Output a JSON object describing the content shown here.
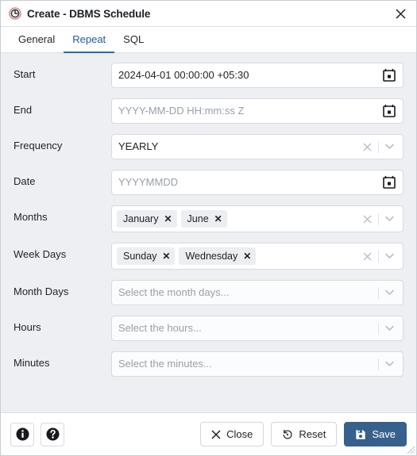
{
  "window": {
    "title": "Create - DBMS Schedule",
    "icon": "clock-icon",
    "close_label": "✕"
  },
  "tabs": [
    {
      "label": "General",
      "active": false
    },
    {
      "label": "Repeat",
      "active": true
    },
    {
      "label": "SQL",
      "active": false
    }
  ],
  "fields": [
    {
      "label": "Start",
      "type": "datetime",
      "value": "2024-04-01 00:00:00 +05:30",
      "placeholder": "YYYY-MM-DD HH:mm:ss Z",
      "icon": "calendar-icon"
    },
    {
      "label": "End",
      "type": "datetime",
      "value": "",
      "placeholder": "YYYY-MM-DD HH:mm:ss Z",
      "icon": "calendar-icon"
    },
    {
      "label": "Frequency",
      "type": "select",
      "value": "YEARLY",
      "placeholder": "",
      "has_clear": true
    },
    {
      "label": "Date",
      "type": "datetime",
      "value": "",
      "placeholder": "YYYYMMDD",
      "icon": "calendar-icon"
    },
    {
      "label": "Months",
      "type": "multiselect",
      "chips": [
        "January",
        "June"
      ],
      "placeholder": "",
      "has_clear": true
    },
    {
      "label": "Week Days",
      "type": "multiselect",
      "chips": [
        "Sunday",
        "Wednesday"
      ],
      "placeholder": "",
      "has_clear": true
    },
    {
      "label": "Month Days",
      "type": "multiselect",
      "chips": [],
      "placeholder": "Select the month days...",
      "has_clear": false
    },
    {
      "label": "Hours",
      "type": "multiselect",
      "chips": [],
      "placeholder": "Select the hours...",
      "has_clear": false
    },
    {
      "label": "Minutes",
      "type": "multiselect",
      "chips": [],
      "placeholder": "Select the minutes...",
      "has_clear": false
    }
  ],
  "footer": {
    "info_icon": "info-icon",
    "help_icon": "help-icon",
    "close_label": "Close",
    "reset_label": "Reset",
    "save_label": "Save"
  },
  "colors": {
    "accent": "#2a6ba8",
    "tab_active_text": "#1f5c99",
    "save_bg": "#37618c",
    "dialog_bg": "#edeff2",
    "panel_bg": "#ffffff",
    "chip_bg": "#eceef1",
    "placeholder_text": "#9aa0a8",
    "clock_ring": "#d98b8b"
  }
}
